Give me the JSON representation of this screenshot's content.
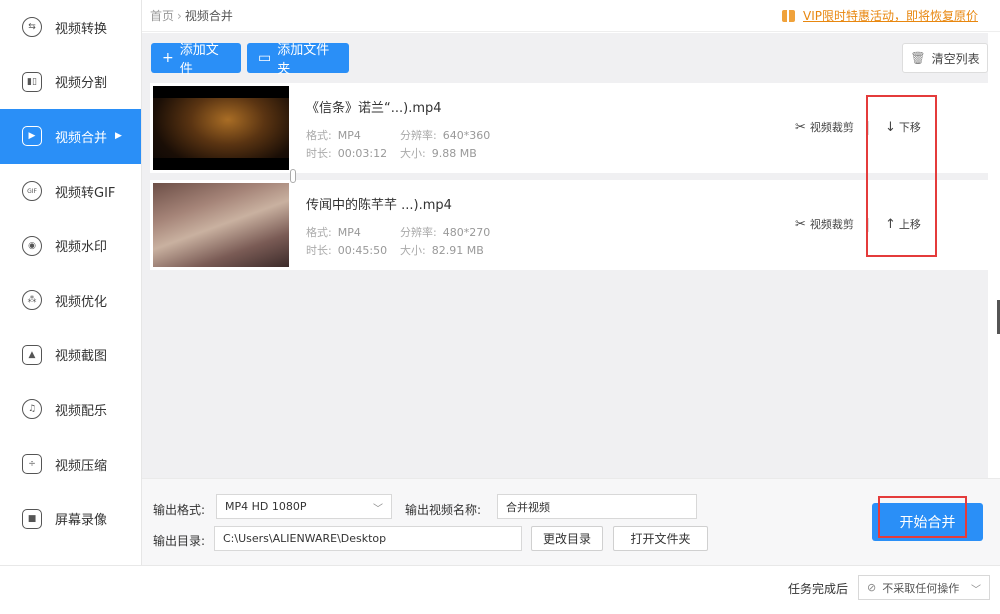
{
  "sidebar": {
    "items": [
      {
        "label": "视频转换",
        "icon": "convert-icon",
        "glyph": "⇆",
        "active": false
      },
      {
        "label": "视频分割",
        "icon": "split-icon",
        "glyph": "▮▯",
        "active": false
      },
      {
        "label": "视频合并",
        "icon": "merge-icon",
        "glyph": "▶",
        "active": true
      },
      {
        "label": "视频转GIF",
        "icon": "gif-icon",
        "glyph": "GIF",
        "active": false
      },
      {
        "label": "视频水印",
        "icon": "watermark-icon",
        "glyph": "◉",
        "active": false
      },
      {
        "label": "视频优化",
        "icon": "optimize-icon",
        "glyph": "⁂",
        "active": false
      },
      {
        "label": "视频截图",
        "icon": "screenshot-icon",
        "glyph": "▲",
        "active": false
      },
      {
        "label": "视频配乐",
        "icon": "music-icon",
        "glyph": "♫",
        "active": false
      },
      {
        "label": "视频压缩",
        "icon": "compress-icon",
        "glyph": "÷",
        "active": false
      },
      {
        "label": "屏幕录像",
        "icon": "record-icon",
        "glyph": "■",
        "active": false
      }
    ],
    "active_arrow": "▶"
  },
  "header": {
    "breadcrumb_home": "首页",
    "breadcrumb_sep": "›",
    "breadcrumb_current": "视频合并",
    "promo_text": "VIP限时特惠活动，即将恢复原价"
  },
  "toolbar": {
    "add_file": "添加文件",
    "add_folder": "添加文件夹",
    "clear_list": "清空列表",
    "add_glyph": "+",
    "folder_glyph": "▭",
    "trash_glyph": "🗑"
  },
  "files": [
    {
      "name": "《信条》诺兰“...).mp4",
      "format_label": "格式:",
      "format": "MP4",
      "resolution_label": "分辨率:",
      "resolution": "640*360",
      "duration_label": "时长:",
      "duration": "00:03:12",
      "size_label": "大小:",
      "size": "9.88 MB",
      "cut_label": "视频裁剪",
      "move_label": "下移",
      "move_glyph": "↓"
    },
    {
      "name": "传闻中的陈芊芊 ...).mp4",
      "format_label": "格式:",
      "format": "MP4",
      "resolution_label": "分辨率:",
      "resolution": "480*270",
      "duration_label": "时长:",
      "duration": "00:45:50",
      "size_label": "大小:",
      "size": "82.91 MB",
      "cut_label": "视频裁剪",
      "move_label": "上移",
      "move_glyph": "↑"
    }
  ],
  "output": {
    "format_label": "输出格式:",
    "format_value": "MP4  HD 1080P",
    "name_label": "输出视频名称:",
    "name_value": "合并视频",
    "dir_label": "输出目录:",
    "dir_value": "C:\\Users\\ALIENWARE\\Desktop",
    "change_dir": "更改目录",
    "open_folder": "打开文件夹",
    "start_button": "开始合并"
  },
  "footer": {
    "after_task_label": "任务完成后",
    "after_task_value": "不采取任何操作",
    "after_task_glyph": "⊘"
  },
  "colors": {
    "accent": "#2a8ff7",
    "promo": "#e8870f",
    "highlight_box": "#e43b3b"
  }
}
